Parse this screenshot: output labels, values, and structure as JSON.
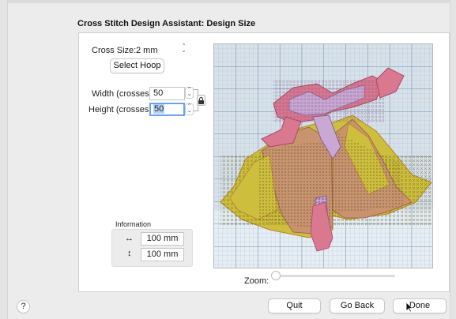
{
  "dialog": {
    "title": "Cross Stitch Design Assistant: Design Size"
  },
  "cross_size": {
    "label": "Cross Size:",
    "value": "2 mm"
  },
  "select_hoop_label": "Select Hoop",
  "width": {
    "label": "Width (crosses):",
    "value": "50"
  },
  "height": {
    "label": "Height (crosses):",
    "value": "50"
  },
  "information": {
    "label": "Information",
    "width_mm": "100 mm",
    "height_mm": "100 mm"
  },
  "zoom": {
    "label": "Zoom:",
    "level": 0
  },
  "footer": {
    "help": "?",
    "quit": "Quit",
    "go_back": "Go Back",
    "done": "Done"
  },
  "icons": {
    "lock": "lock-icon",
    "horizontal": "horizontal-arrow-icon",
    "vertical": "vertical-arrow-icon",
    "stepper": "stepper-icon",
    "popup": "popup-chevron-icon"
  },
  "colors": {
    "grid_line": "#8fa6bd",
    "background_fabric": "#d6e1ea",
    "yellow_stitch": "#cdbf3d",
    "tan_stitch": "#c8946e",
    "pink_stitch": "#d9788f",
    "lilac_stitch": "#c9a9d4",
    "focus_ring": "#6aa3ef"
  }
}
